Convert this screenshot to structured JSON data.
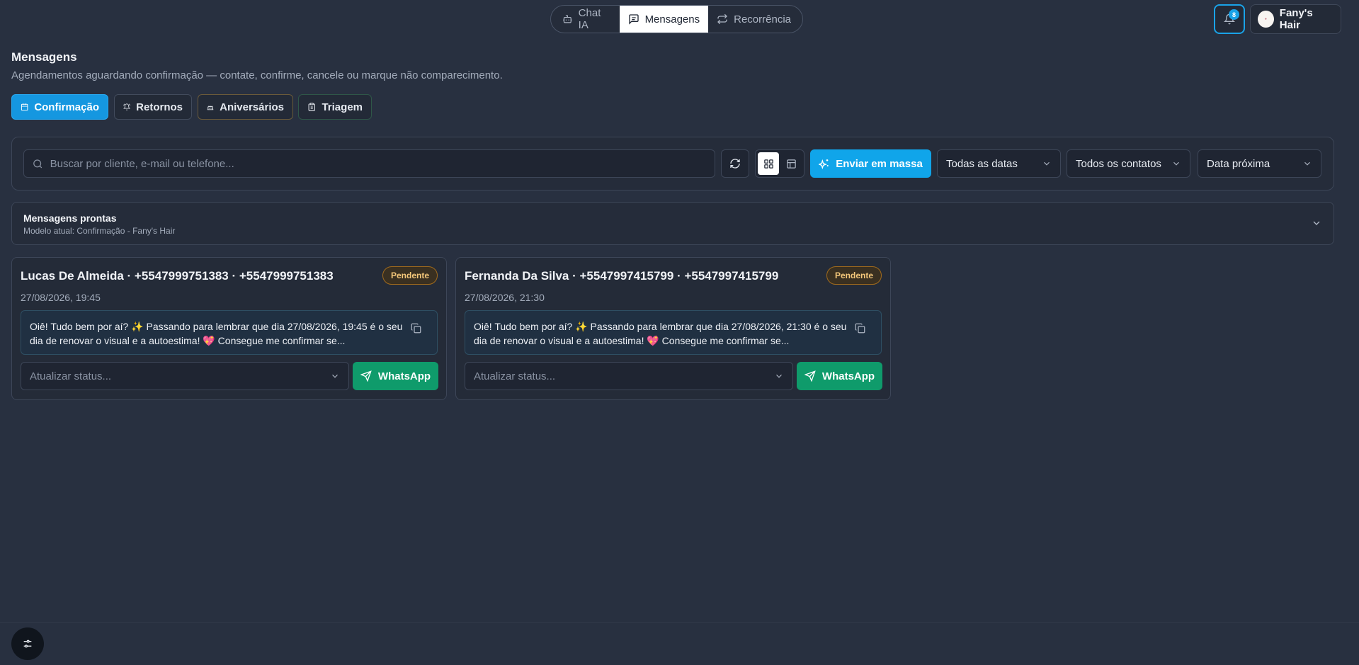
{
  "topnav": {
    "tabs": [
      {
        "label": "Chat IA",
        "icon": "bot-icon",
        "active": false
      },
      {
        "label": "Mensagens",
        "icon": "message-square-icon",
        "active": true
      },
      {
        "label": "Recorrência",
        "icon": "repeat-icon",
        "active": false
      }
    ]
  },
  "header": {
    "notification_count": "8",
    "profile_name": "Fany's Hair"
  },
  "page": {
    "title": "Mensagens",
    "subtitle": "Agendamentos aguardando confirmação — contate, confirme, cancele ou marque não comparecimento."
  },
  "filter_tabs": [
    {
      "label": "Confirmação",
      "icon": "calendar-icon",
      "active": true
    },
    {
      "label": "Retornos",
      "icon": "bell-ring-icon",
      "active": false
    },
    {
      "label": "Aniversários",
      "icon": "cake-icon",
      "active": false
    },
    {
      "label": "Triagem",
      "icon": "clipboard-icon",
      "active": false
    }
  ],
  "toolbar": {
    "search_placeholder": "Buscar por cliente, e-mail ou telefone...",
    "mass_send_label": "Enviar em massa",
    "date_filter": "Todas as datas",
    "contact_filter": "Todos os contatos",
    "sort": "Data próxima"
  },
  "ready_messages": {
    "title": "Mensagens prontas",
    "subtitle": "Modelo atual: Confirmação - Fany's Hair"
  },
  "cards": [
    {
      "title": "Lucas De Almeida · +5547999751383 · +5547999751383",
      "status": "Pendente",
      "date": "27/08/2026, 19:45",
      "message": "Oiê! Tudo bem por aí? ✨ Passando para lembrar que dia 27/08/2026, 19:45 é o seu dia de renovar o visual e a autoestima! 💖 Consegue me confirmar se...",
      "status_placeholder": "Atualizar status...",
      "action_label": "WhatsApp"
    },
    {
      "title": "Fernanda Da Silva · +5547997415799 · +5547997415799",
      "status": "Pendente",
      "date": "27/08/2026, 21:30",
      "message": "Oiê! Tudo bem por aí? ✨ Passando para lembrar que dia 27/08/2026, 21:30 é o seu dia de renovar o visual e a autoestima! 💖 Consegue me confirmar se...",
      "status_placeholder": "Atualizar status...",
      "action_label": "WhatsApp"
    }
  ],
  "colors": {
    "background": "#283040",
    "accent": "#1597e0",
    "whatsapp": "#0f9b6b",
    "pending_badge": "#f4c77a"
  }
}
